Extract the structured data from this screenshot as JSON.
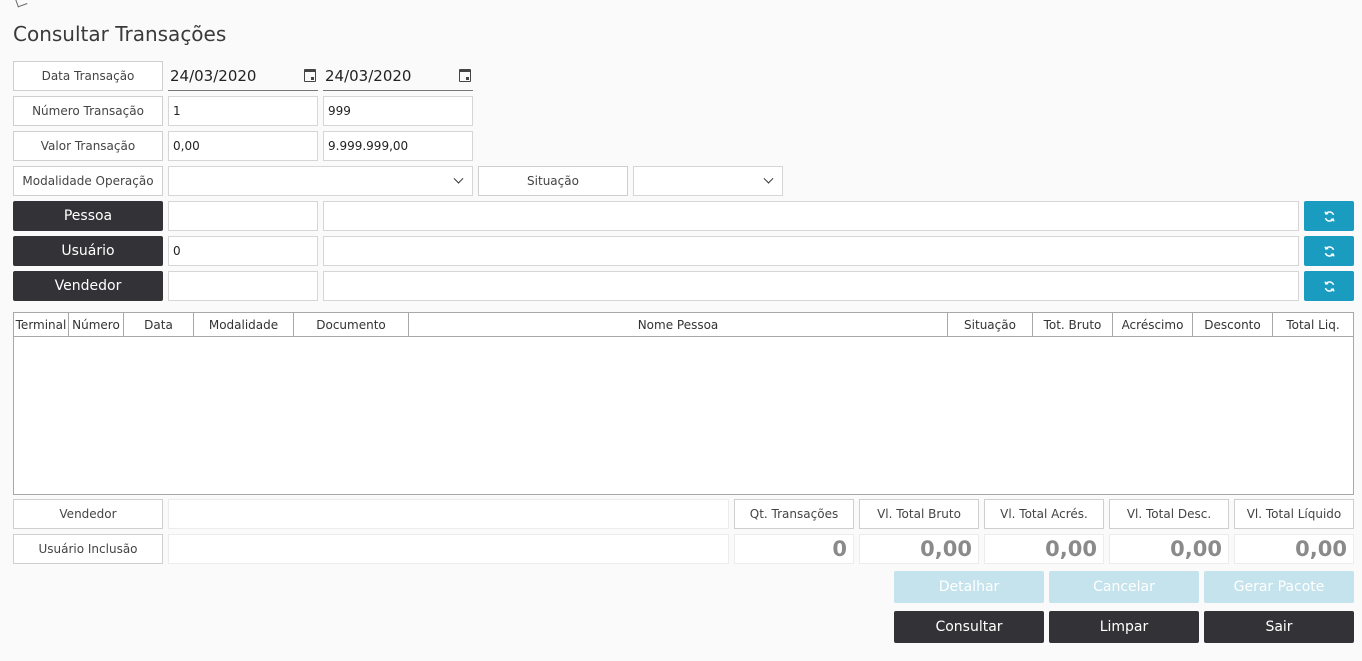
{
  "title": "Consultar Transações",
  "filters": {
    "data_label": "Data Transação",
    "data_inicio": "24/03/2020",
    "data_fim": "24/03/2020",
    "numero_label": "Número Transação",
    "numero_inicio": "1",
    "numero_fim": "999",
    "valor_label": "Valor Transação",
    "valor_inicio": "0,00",
    "valor_fim": "9.999.999,00",
    "modalidade_label": "Modalidade Operação",
    "modalidade_value": "",
    "situacao_label": "Situação",
    "situacao_value": "",
    "pessoa_label": "Pessoa",
    "pessoa_codigo": "",
    "pessoa_nome": "",
    "usuario_label": "Usuário",
    "usuario_codigo": "0",
    "usuario_nome": "",
    "vendedor_label": "Vendedor",
    "vendedor_codigo": "",
    "vendedor_nome": ""
  },
  "grid": {
    "columns": [
      "Terminal",
      "Número",
      "Data",
      "Modalidade",
      "Documento",
      "Nome Pessoa",
      "Situação",
      "Tot. Bruto",
      "Acréscimo",
      "Desconto",
      "Total Liq."
    ],
    "rows": []
  },
  "summary": {
    "vendedor_label": "Vendedor",
    "vendedor_value": "",
    "usuario_inclusao_label": "Usuário Inclusão",
    "usuario_inclusao_value": "",
    "qt_label": "Qt. Transações",
    "qt_value": "0",
    "bruto_label": "Vl. Total Bruto",
    "bruto_value": "0,00",
    "acres_label": "Vl. Total Acrés.",
    "acres_value": "0,00",
    "desc_label": "Vl. Total Desc.",
    "desc_value": "0,00",
    "liquido_label": "Vl. Total Líquido",
    "liquido_value": "0,00"
  },
  "actions": {
    "detalhar": "Detalhar",
    "cancelar": "Cancelar",
    "gerar_pacote": "Gerar Pacote",
    "consultar": "Consultar",
    "limpar": "Limpar",
    "sair": "Sair"
  },
  "colors": {
    "dark_button": "#333337",
    "refresh_button": "#1a9bc0",
    "disabled_button": "#c4e3ec"
  },
  "icons": [
    "calendar-icon",
    "chevron-down-icon",
    "refresh-icon"
  ]
}
